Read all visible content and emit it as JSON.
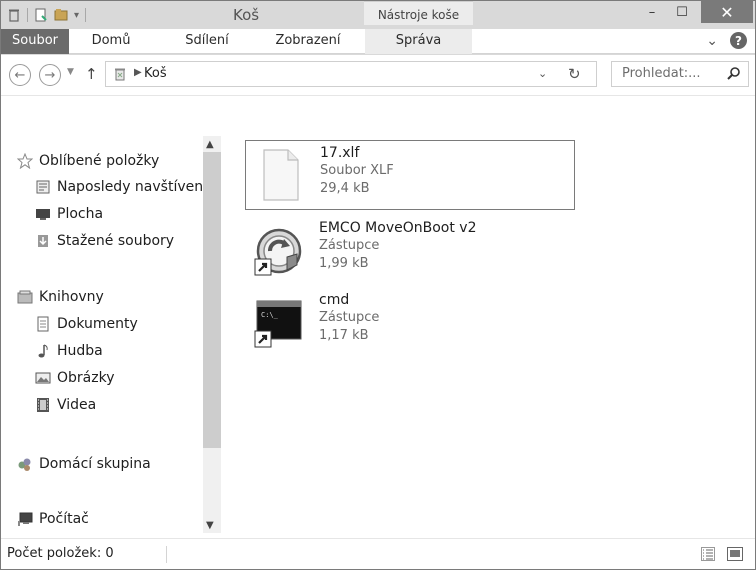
{
  "window": {
    "title": "Koš",
    "tools_tab": "Nástroje koše",
    "close_glyph": "✕",
    "min_glyph": "–",
    "max_glyph": "☐"
  },
  "ribbon": {
    "tabs": [
      {
        "label": "Soubor"
      },
      {
        "label": "Domů"
      },
      {
        "label": "Sdílení"
      },
      {
        "label": "Zobrazení"
      },
      {
        "label": "Správa"
      }
    ],
    "expand_glyph": "⌄",
    "help_glyph": "?"
  },
  "address": {
    "path": "Koš",
    "search_placeholder": "Prohledat:..."
  },
  "sidebar": {
    "items": [
      {
        "label": "Oblíbené položky",
        "icon": "star-icon"
      },
      {
        "label": "Naposledy navštívené",
        "icon": "recent-places-icon"
      },
      {
        "label": "Plocha",
        "icon": "desktop-icon"
      },
      {
        "label": "Stažené soubory",
        "icon": "downloads-icon"
      },
      {
        "label": "Knihovny",
        "icon": "library-icon"
      },
      {
        "label": "Dokumenty",
        "icon": "document-icon"
      },
      {
        "label": "Hudba",
        "icon": "music-icon"
      },
      {
        "label": "Obrázky",
        "icon": "pictures-icon"
      },
      {
        "label": "Videa",
        "icon": "video-icon"
      },
      {
        "label": "Domácí skupina",
        "icon": "homegroup-icon"
      },
      {
        "label": "Počítač",
        "icon": "computer-icon"
      }
    ]
  },
  "files": [
    {
      "name": "17.xlf",
      "type": "Soubor XLF",
      "size": "29,4 kB",
      "icon": "blank-file-icon"
    },
    {
      "name": "EMCO MoveOnBoot v2",
      "type": "Zástupce",
      "size": "1,99 kB",
      "icon": "emco-shortcut-icon"
    },
    {
      "name": "cmd",
      "type": "Zástupce",
      "size": "1,17 kB",
      "icon": "cmd-shortcut-icon"
    }
  ],
  "status": {
    "text": "Počet položek: 0"
  },
  "colors": {
    "file_tab": "#6b6b6b",
    "close_button": "#7a7a7a",
    "selection_border": "#7a7a7a"
  }
}
